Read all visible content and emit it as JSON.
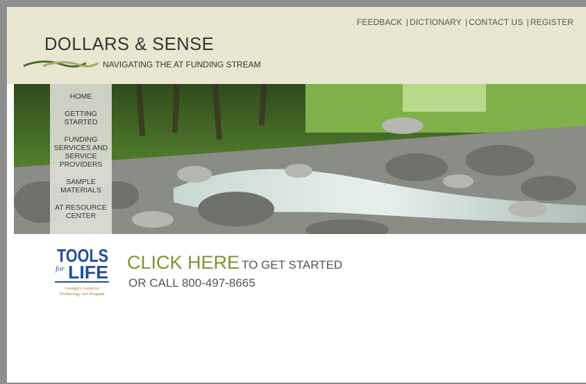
{
  "top_nav": {
    "feedback": "FEEDBACK",
    "dictionary": "DICTIONARY",
    "contact": "CONTACT US",
    "register": "REGISTER",
    "separator": "|"
  },
  "header": {
    "title": "DOLLARS & SENSE",
    "tagline": "NAVIGATING THE AT FUNDING STREAM"
  },
  "side_nav": {
    "home": "HOME",
    "getting_started": "GETTING STARTED",
    "funding_services": "FUNDING SERVICES AND SERVICE PROVIDERS",
    "sample_materials": "SAMPLE MATERIALS",
    "at_resource": "AT RESOURCE CENTER"
  },
  "tools_logo": {
    "line1": "TOOLS",
    "line2": "LIFE",
    "for": "for",
    "subtitle_1": "Georgia's Assistive",
    "subtitle_2": "Technology Act Program"
  },
  "cta": {
    "click_here": "CLICK HERE",
    "rest": "TO GET STARTED",
    "call": "OR CALL 800-497-8665"
  },
  "colors": {
    "header_bg": "#e9e6d1",
    "cta_green": "#858f31",
    "logo_blue": "#1f4e9c"
  }
}
